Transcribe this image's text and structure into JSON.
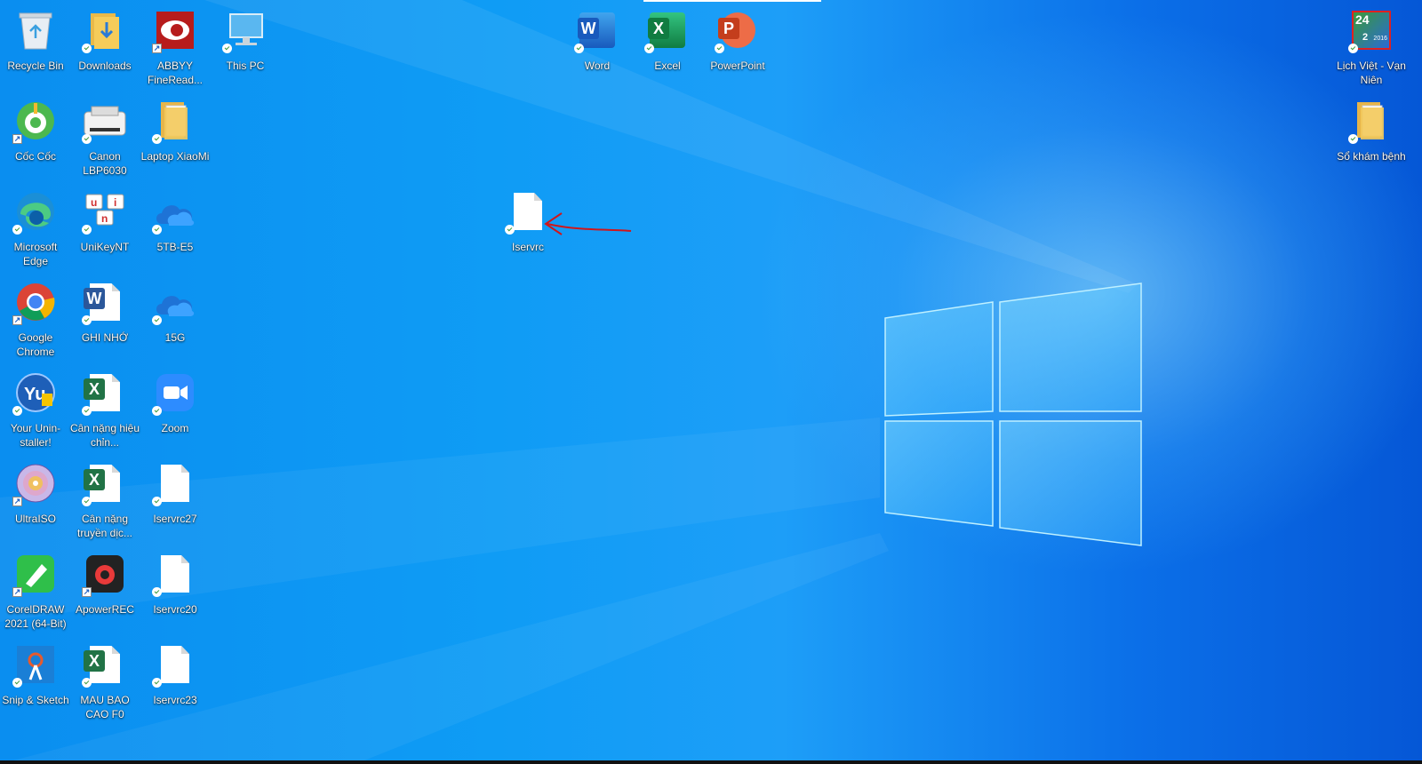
{
  "desktop": {
    "icons": {
      "recycle_bin": "Recycle Bin",
      "downloads": "Downloads",
      "abbyy": "ABBYY FineRead...",
      "this_pc": "This PC",
      "coc_coc": "Cốc Cốc",
      "canon": "Canon LBP6030",
      "laptop_xiaomi": "Laptop XiaoMi",
      "edge": "Microsoft Edge",
      "unikey": "UniKeyNT",
      "stb_e5": "5TB-E5",
      "chrome": "Google Chrome",
      "ghi_nho": "GHI NHỚ",
      "g15": "15G",
      "uninstaller": "Your Unin-staller!",
      "can_nang_hieu": "Cân nặng hiệu chỉn...",
      "zoom": "Zoom",
      "ultraiso": "UltraISO",
      "can_nang_truyen": "Cân nặng truyền dịc...",
      "iservrc27": "Iservrc27",
      "coreldraw": "CorelDRAW 2021 (64-Bit)",
      "apowerrec": "ApowerREC",
      "iservrc20": "Iservrc20",
      "snip": "Snip & Sketch",
      "mau_bao_cao": "MAU BAO CAO F0",
      "iservrc23": "Iservrc23",
      "iservrc": "Iservrc",
      "word": "Word",
      "excel": "Excel",
      "powerpoint": "PowerPoint",
      "lich_viet": "Lịch Việt - Vạn Niên",
      "so_kham_benh": "Sổ khám bệnh"
    },
    "lich_viet_tile": {
      "day": "24",
      "month": "2",
      "year": "2016"
    },
    "letters": {
      "word": "W",
      "excel": "X",
      "powerpoint": "P",
      "uninstaller": "Yu",
      "unikey_top": "u",
      "unikey_mid": "i",
      "unikey_bot": "n"
    }
  },
  "colors": {
    "wallpaper_blue": "#0f9cf5",
    "word": "#2b579a",
    "excel": "#217346",
    "powerpoint": "#d24726",
    "annotation_arrow": "#d0161b"
  }
}
